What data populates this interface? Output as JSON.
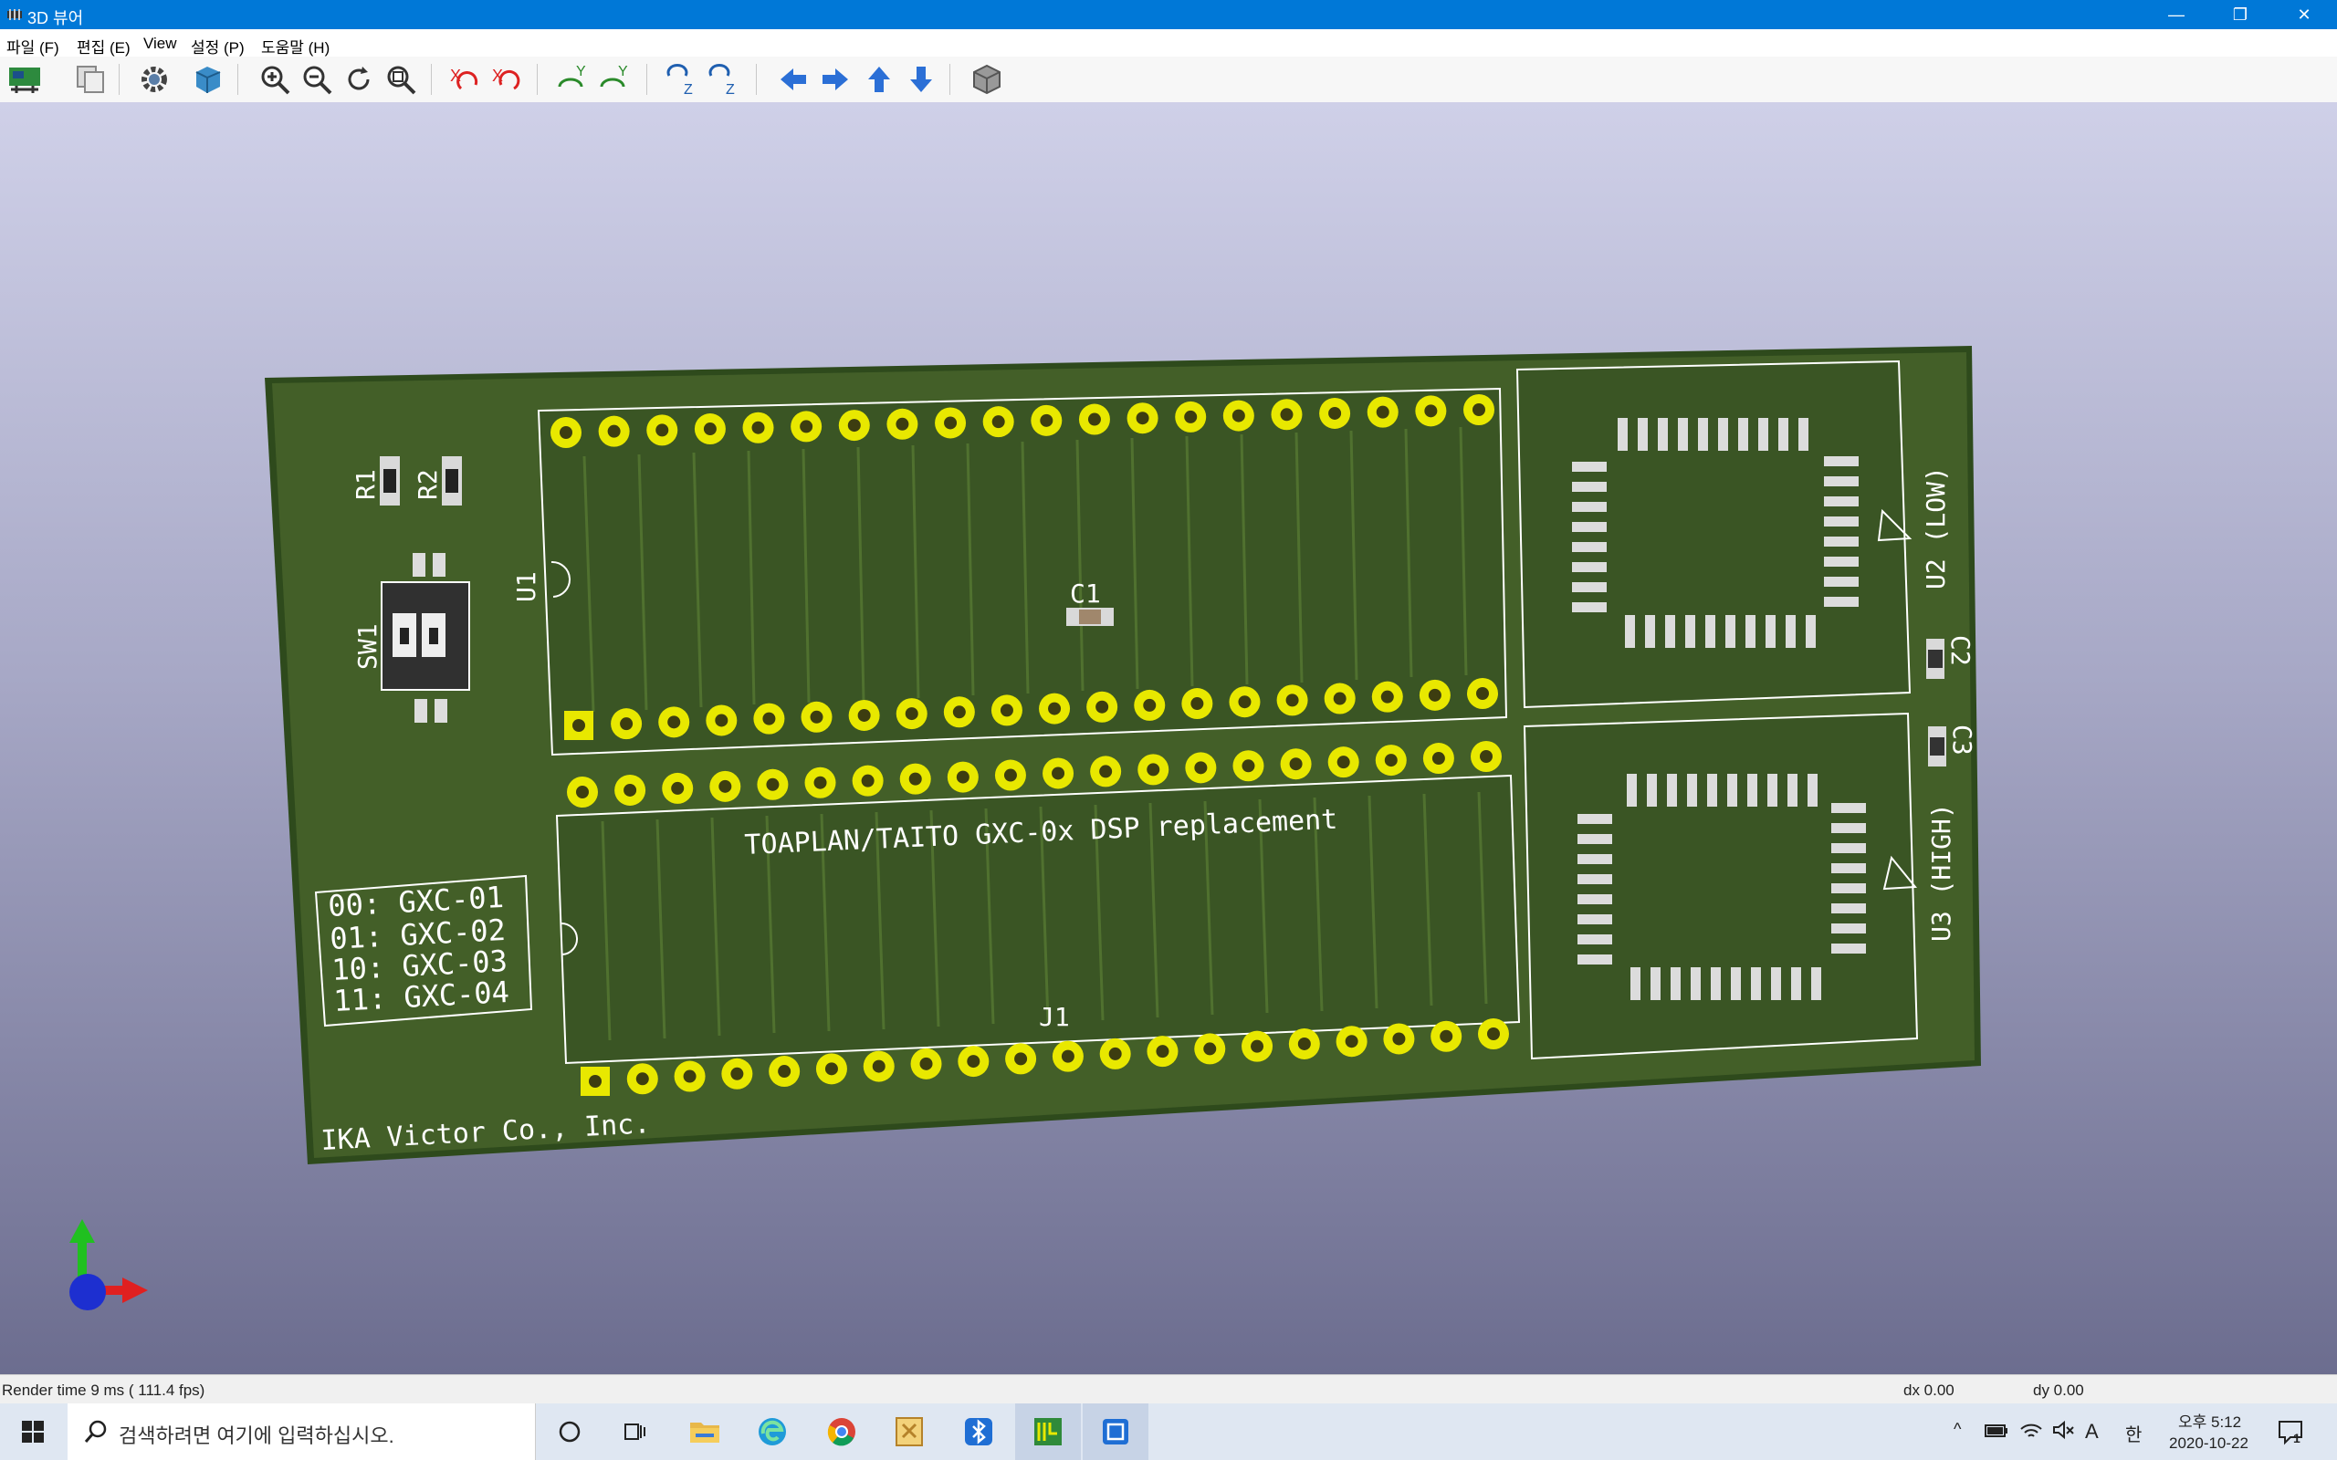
{
  "window": {
    "title": "3D 뷰어",
    "minimize": "—",
    "maximize": "❐",
    "close": "✕"
  },
  "menu": [
    "파일 (F)",
    "편집 (E)",
    "View",
    "설정 (P)",
    "도움말 (H)"
  ],
  "toolbar": {
    "buttons": [
      "reload-board-icon",
      "copy-icon",
      "settings-gear-icon",
      "render-mode-icon",
      "zoom-in-icon",
      "zoom-out-icon",
      "redraw-icon",
      "zoom-fit-icon",
      "rotate-x-cw-icon",
      "rotate-x-ccw-icon",
      "rotate-y-cw-icon",
      "rotate-y-ccw-icon",
      "rotate-z-cw-icon",
      "rotate-z-ccw-icon",
      "move-left-icon",
      "move-right-icon",
      "move-up-icon",
      "move-down-icon",
      "orthographic-toggle-icon"
    ]
  },
  "board": {
    "silkscreen": {
      "title": "TOAPLAN/TAITO GXC-0x DSP replacement",
      "company": "IKA Victor Co., Inc.",
      "config_table": [
        "00: GXC-01",
        "01: GXC-02",
        "10: GXC-03",
        "11: GXC-04"
      ],
      "refs": {
        "r1": "R1",
        "r2": "R2",
        "sw1": "SW1",
        "u1": "U1",
        "c1": "C1",
        "c2": "C2",
        "c3": "C3",
        "j1": "J1",
        "u2": "U2 (LOW)",
        "u3": "U3 (HIGH)"
      }
    },
    "colors": {
      "mask": "#4a6a2a",
      "copper": "#2f4e1d",
      "pad": "#e8e800",
      "silk": "#ffffff"
    }
  },
  "status": {
    "render": "Render time 9 ms ( 111.4 fps)",
    "dx": "dx 0.00",
    "dy": "dy 0.00"
  },
  "taskbar": {
    "search_placeholder": "검색하려면 여기에 입력하십시오.",
    "apps": [
      "task-view-icon",
      "file-explorer-icon",
      "edge-icon",
      "chrome-icon",
      "archive-icon",
      "bluetooth-app-icon",
      "kicad-pcbnew-icon",
      "kicad-3d-viewer-icon"
    ],
    "clock_time": "오후 5:12",
    "clock_date": "2020-10-22",
    "ime": "한",
    "lang": "A",
    "notif_count": "1"
  }
}
